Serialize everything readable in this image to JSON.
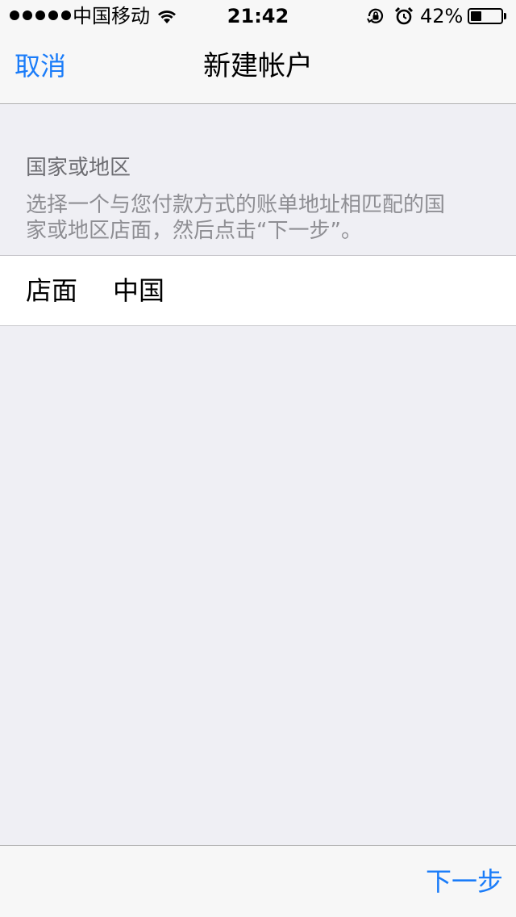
{
  "status_bar": {
    "carrier": "中国移动",
    "time": "21:42",
    "battery_percent": "42%",
    "battery_level": 0.42,
    "signal_dots": 5,
    "icons": [
      "wifi-icon",
      "orientation-lock-icon",
      "alarm-icon",
      "battery-icon"
    ]
  },
  "nav": {
    "cancel_label": "取消",
    "title": "新建帐户"
  },
  "section": {
    "title": "国家或地区",
    "description": "选择一个与您付款方式的账单地址相匹配的国\n家或地区店面，然后点击“下一步”。"
  },
  "store_row": {
    "label": "店面",
    "value": "中国"
  },
  "toolbar": {
    "next_label": "下一步"
  },
  "colors": {
    "accent": "#1a7cf9",
    "background": "#efeff4",
    "bar": "#f7f7f7"
  }
}
